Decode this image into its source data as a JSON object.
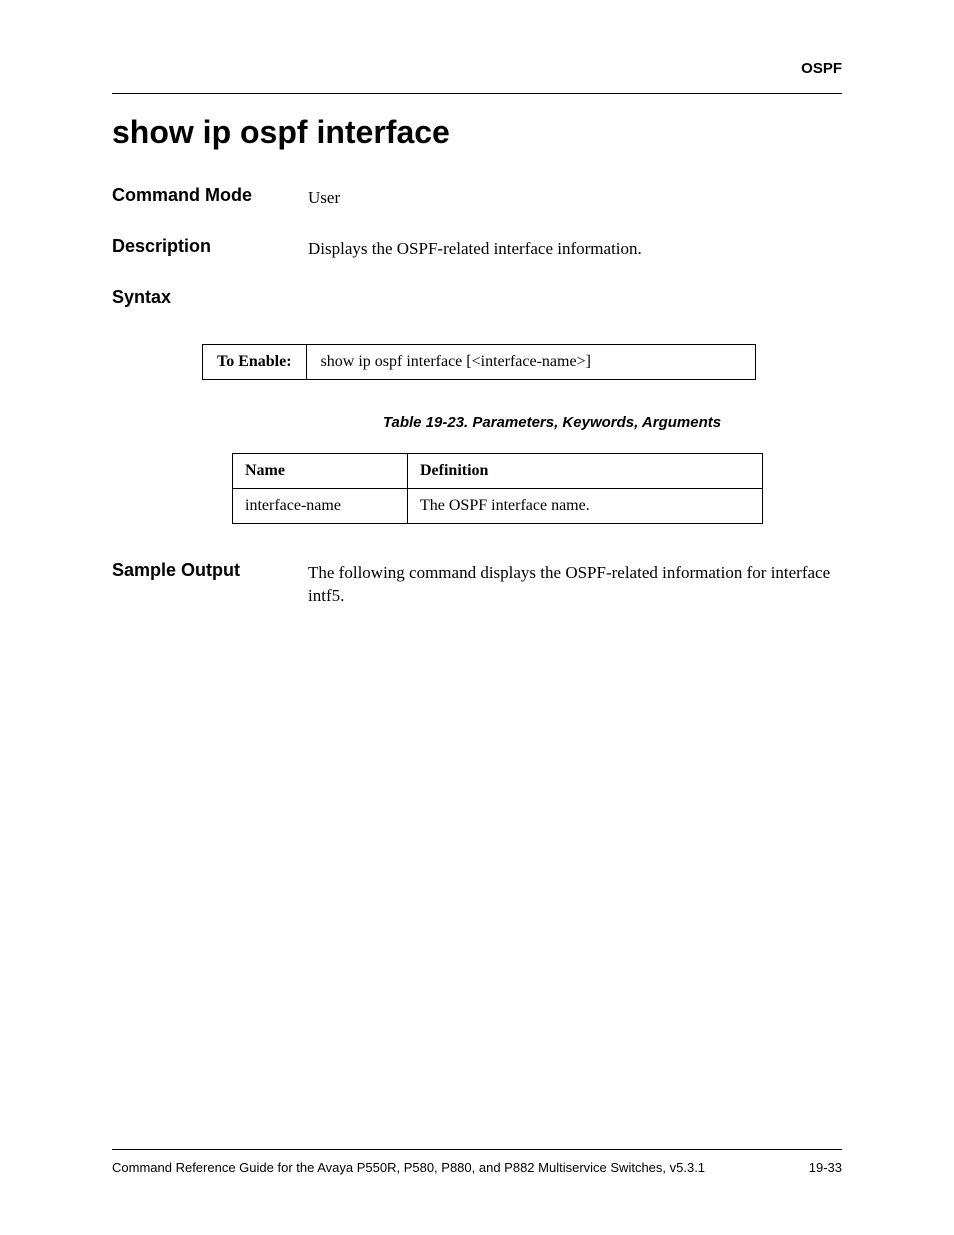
{
  "header": {
    "section": "OSPF"
  },
  "title": "show ip ospf interface",
  "command_mode": {
    "label": "Command Mode",
    "value": "User"
  },
  "description": {
    "label": "Description",
    "value": "Displays the OSPF-related interface information."
  },
  "syntax": {
    "label": "Syntax",
    "enable_label": "To Enable:",
    "enable_command": "show ip ospf interface [<interface-name>]"
  },
  "table_caption": "Table 19-23.  Parameters, Keywords, Arguments",
  "param_table": {
    "headers": {
      "name": "Name",
      "definition": "Definition"
    },
    "rows": [
      {
        "name": "interface-name",
        "definition": "The OSPF interface name."
      }
    ]
  },
  "sample_output": {
    "label": "Sample Output",
    "value": "The following command displays the OSPF-related information for interface intf5."
  },
  "footer": {
    "left": "Command Reference Guide for the Avaya P550R, P580, P880, and P882 Multiservice Switches, v5.3.1",
    "right": "19-33"
  }
}
